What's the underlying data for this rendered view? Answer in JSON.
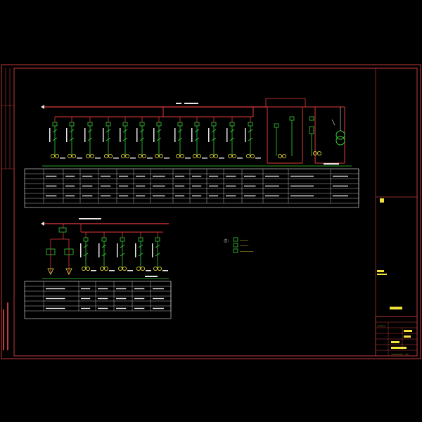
{
  "drawing": {
    "upper_bus_label": "~~~",
    "lower_bus_label": "~~~",
    "legend_title": "注：",
    "legend_items": [
      {
        "icon": "breaker-symbol-icon",
        "text": "~~~~~"
      },
      {
        "icon": "contactor-symbol-icon",
        "text": "~~~~~"
      },
      {
        "icon": "meter-symbol-icon",
        "text": "~~~~~~~~"
      }
    ],
    "title_block": {
      "project": "~~~",
      "drawing_name": "~~~~~",
      "drawing_no": "~~~~~~~",
      "sheet": "~~"
    }
  },
  "colors": {
    "frame": "#c23a3a",
    "bus": "#e23a3a",
    "feeder": "#35d135",
    "device": "#f2e13a",
    "text": "#e8e8e8",
    "cyan": "#38c8d8"
  }
}
